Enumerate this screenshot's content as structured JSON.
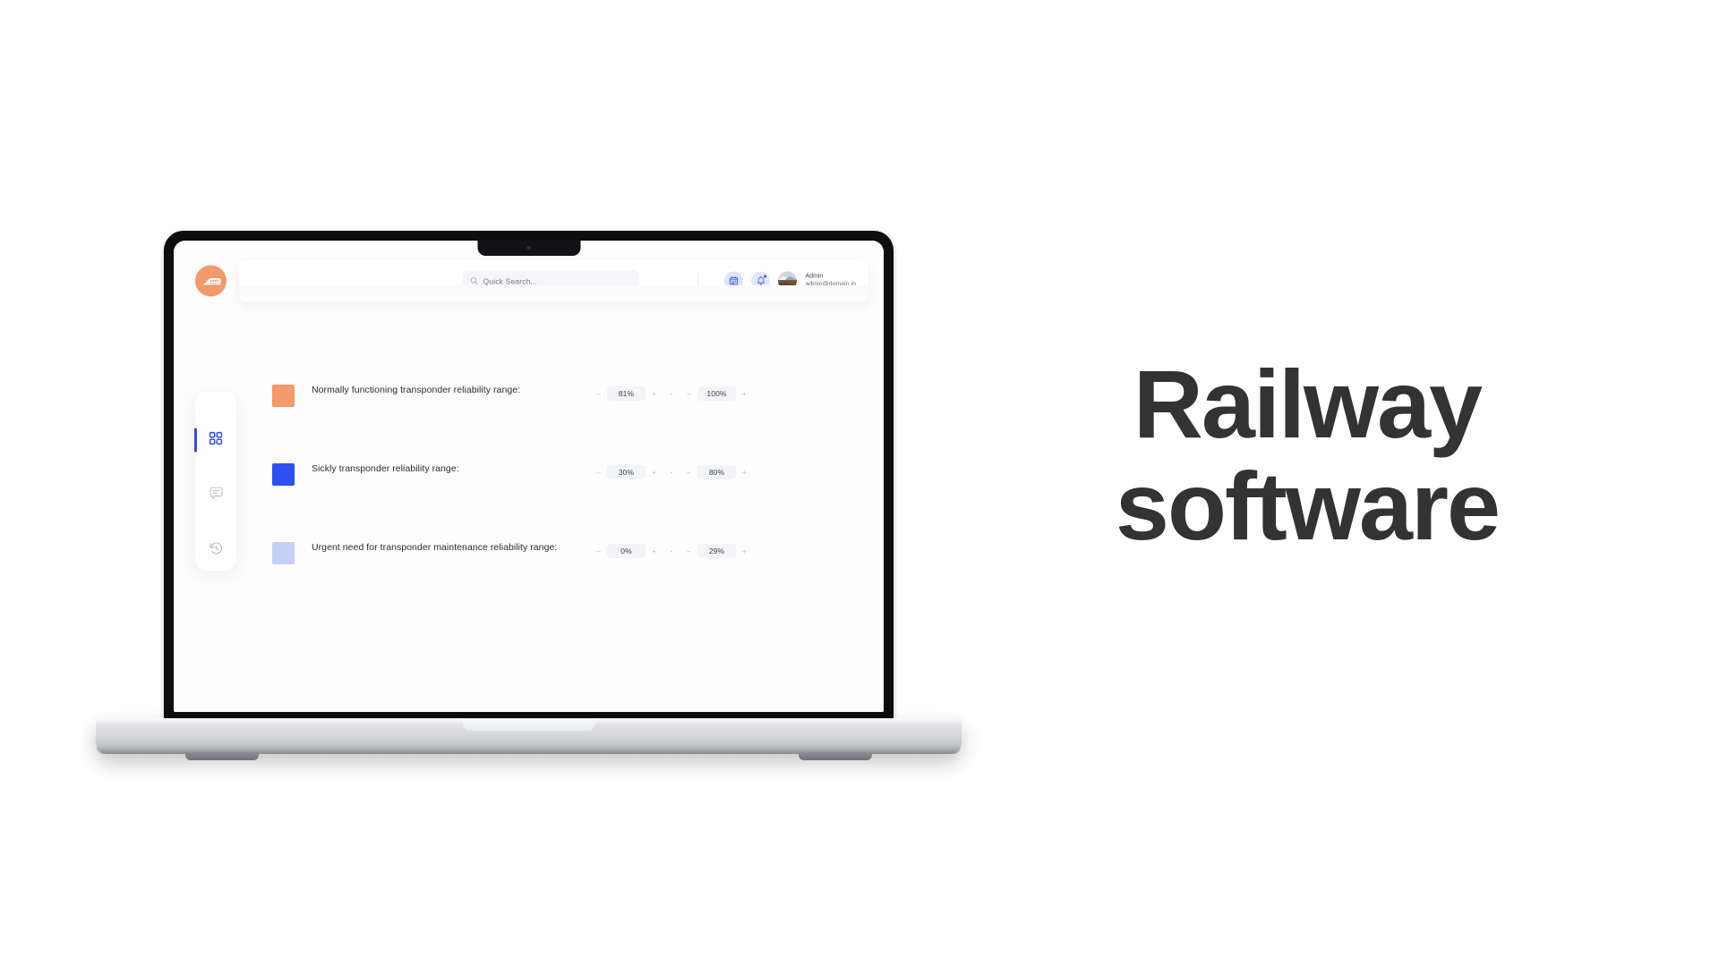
{
  "headline": {
    "line1": "Railway",
    "line2": "software"
  },
  "app": {
    "logo_icon": "train-logo-icon",
    "search": {
      "placeholder": "Quick Search...",
      "value": "",
      "icon": "search-icon"
    },
    "actions": {
      "calendar_icon": "calendar-icon",
      "notifications_icon": "bell-icon",
      "notification_dot": true
    },
    "user": {
      "name": "Admin",
      "email": "admin@domain.in",
      "avatar_icon": "avatar"
    },
    "sidebar": {
      "items": [
        {
          "id": "dashboard",
          "icon": "grid-icon",
          "active": true
        },
        {
          "id": "messages",
          "icon": "chat-bubble-icon",
          "active": false
        },
        {
          "id": "history",
          "icon": "history-clock-icon",
          "active": false
        }
      ]
    },
    "settings_rows": [
      {
        "label": "Normally functioning transponder reliability range:",
        "color": "#F4996A",
        "min": "81%",
        "max": "100%",
        "separator": "-",
        "decrement": "–",
        "increment": "+"
      },
      {
        "label": "Sickly transponder reliability range:",
        "color": "#2F4FF0",
        "min": "30%",
        "max": "80%",
        "separator": "-",
        "decrement": "–",
        "increment": "+"
      },
      {
        "label": "Urgent need for transponder maintenance reliability range:",
        "color": "#C6CFF7",
        "min": "0%",
        "max": "29%",
        "separator": "-",
        "decrement": "–",
        "increment": "+"
      }
    ]
  },
  "colors": {
    "accent_blue": "#2F4FF0",
    "accent_orange": "#F4996A",
    "accent_light_blue": "#C6CFF7",
    "page_bg": "#FFFFFF",
    "headline": "#333333"
  }
}
